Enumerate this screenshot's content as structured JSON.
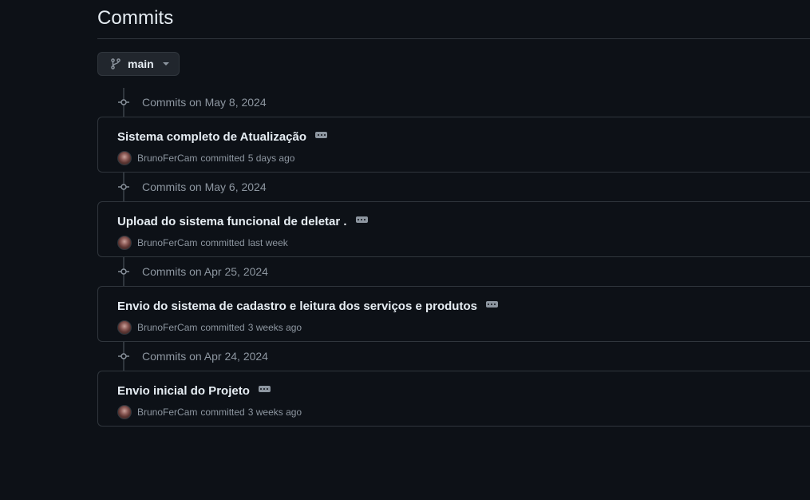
{
  "page": {
    "title": "Commits"
  },
  "branch": {
    "label": "main",
    "icon": "git-branch-icon"
  },
  "groups": [
    {
      "date_label": "Commits on May 8, 2024",
      "commits": [
        {
          "title": "Sistema completo de Atualização",
          "author": "BrunoFerCam",
          "action": "committed",
          "time": "5 days ago"
        }
      ]
    },
    {
      "date_label": "Commits on May 6, 2024",
      "commits": [
        {
          "title": "Upload do sistema funcional de deletar .",
          "author": "BrunoFerCam",
          "action": "committed",
          "time": "last week"
        }
      ]
    },
    {
      "date_label": "Commits on Apr 25, 2024",
      "commits": [
        {
          "title": "Envio do sistema de cadastro e leitura dos serviços e produtos",
          "author": "BrunoFerCam",
          "action": "committed",
          "time": "3 weeks ago"
        }
      ]
    },
    {
      "date_label": "Commits on Apr 24, 2024",
      "commits": [
        {
          "title": "Envio inicial do Projeto",
          "author": "BrunoFerCam",
          "action": "committed",
          "time": "3 weeks ago"
        }
      ]
    }
  ],
  "colors": {
    "background": "#0d1117",
    "border": "#30363d",
    "text_primary": "#e6edf3",
    "text_muted": "#8d96a0",
    "button_bg": "#21262d"
  }
}
